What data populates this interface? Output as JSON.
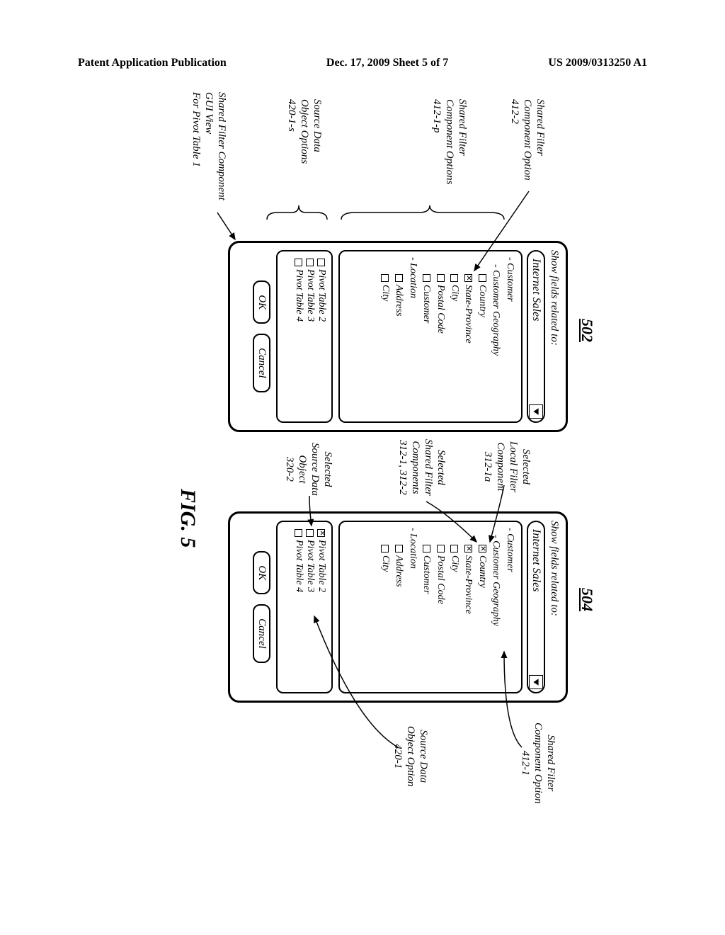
{
  "header": {
    "left": "Patent Application Publication",
    "center": "Dec. 17, 2009  Sheet 5 of 7",
    "right": "US 2009/0313250 A1"
  },
  "refs": {
    "panel502": "502",
    "panel504": "504"
  },
  "dialog": {
    "title": "Show fields related to:",
    "dropdown_value": "Internet Sales",
    "tree": {
      "customer": "- Customer",
      "customer_geo": "- Customer Geography",
      "country": "Country",
      "state_province": "State-Province",
      "city": "City",
      "postal_code": "Postal Code",
      "customer_leaf": "Customer",
      "location": "- Location",
      "address": "Address",
      "city2": "City"
    },
    "pivots": {
      "p2": "Pivot Table 2",
      "p3": "Pivot Table 3",
      "p4": "Pivot Table 4"
    },
    "ok": "OK",
    "cancel": "Cancel"
  },
  "callouts": {
    "sfco_412_2": {
      "t1": "Shared Filter",
      "t2": "Component Option",
      "ref": "412-2"
    },
    "sfco_412_1p": {
      "t1": "Shared Filter",
      "t2": "Component Options",
      "ref": "412-1-p"
    },
    "sdo_420_1s": {
      "t1": "Source Data",
      "t2": "Object Options",
      "ref": "420-1-s"
    },
    "sfc_gui": {
      "t1": "Shared Filter Component",
      "t2": "GUI View",
      "t3": "For Pivot Table 1"
    },
    "sel_local": {
      "t1": "Selected",
      "t2": "Local Filter",
      "t3": "Component",
      "ref": "312-1a"
    },
    "sel_shared": {
      "t1": "Selected",
      "t2": "Shared Filter",
      "t3": "Components",
      "ref": "312-1, 312-2"
    },
    "sel_source": {
      "t1": "Selected",
      "t2": "Source Data",
      "t3": "Object",
      "ref": "320-2"
    },
    "sfco_412_1": {
      "t1": "Shared Filter",
      "t2": "Component Option",
      "ref": "412-1"
    },
    "sdo_420_1": {
      "t1": "Source Data",
      "t2": "Object Option",
      "ref": "420-1"
    }
  },
  "figure_label": "FIG. 5"
}
